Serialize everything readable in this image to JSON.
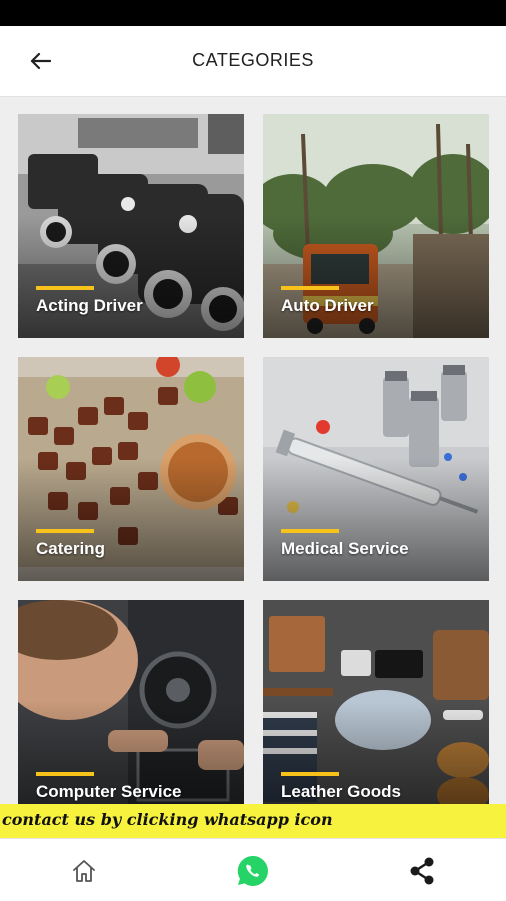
{
  "header": {
    "title": "CATEGORIES",
    "back_icon": "arrow-left-icon"
  },
  "categories": [
    {
      "label": "Acting Driver"
    },
    {
      "label": "Auto Driver"
    },
    {
      "label": "Catering"
    },
    {
      "label": "Medical Service"
    },
    {
      "label": "Computer Service"
    },
    {
      "label": "Leather Goods"
    }
  ],
  "banner": {
    "text": "contact us by clicking whatsapp icon"
  },
  "bottom_nav": {
    "items": [
      "home-icon",
      "whatsapp-icon",
      "share-icon"
    ]
  },
  "colors": {
    "accent": "#f7c31a",
    "banner": "#f7f23d",
    "whatsapp": "#25d366"
  }
}
